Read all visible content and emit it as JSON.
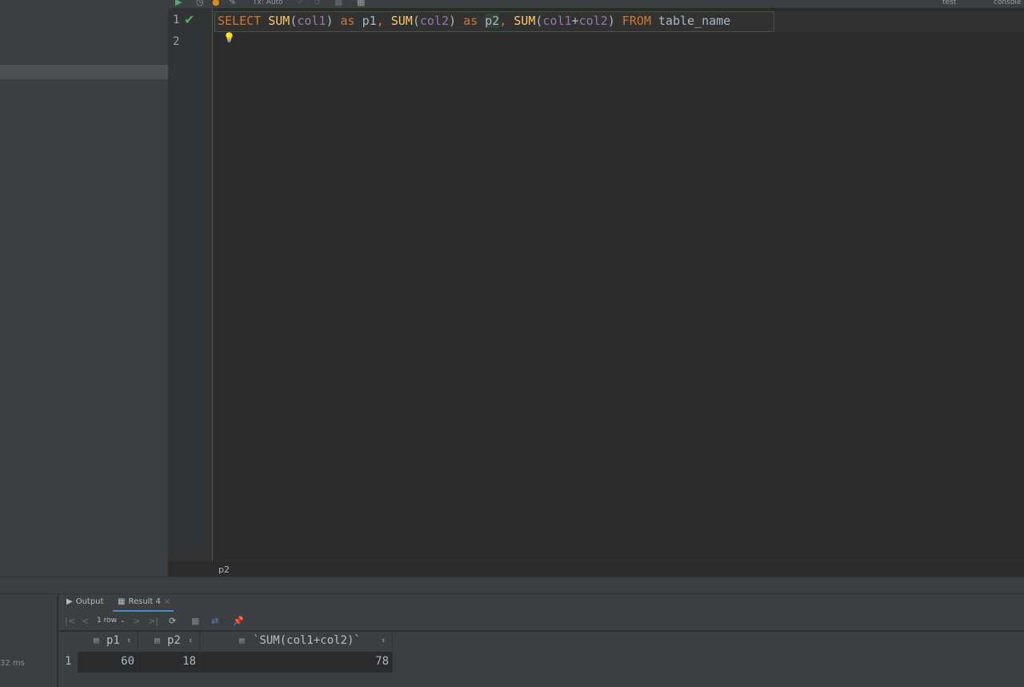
{
  "toolbar": {
    "tx_mode": "Tx: Auto",
    "datasource": "test",
    "console": "console"
  },
  "editor": {
    "line_numbers": [
      "1",
      "2"
    ],
    "code": {
      "select": "SELECT",
      "sum1": "SUM",
      "col1a": "col1",
      "as1": "as",
      "p1": "p1",
      "sum2": "SUM",
      "col2a": "col2",
      "as2": "as",
      "p2": "p2",
      "sum3": "SUM",
      "col1b": "col1",
      "plus": "+",
      "col2b": "col2",
      "from": "FROM",
      "table": "table_name"
    }
  },
  "breadcrumb": "p2",
  "bottom": {
    "time": "32 ms",
    "tabs": [
      {
        "label": "Output"
      },
      {
        "label": "Result 4"
      }
    ],
    "row_count": "1 row",
    "columns": [
      "p1",
      "p2",
      "`SUM(col1+col2)`"
    ],
    "rows": [
      {
        "num": "1",
        "cells": [
          "60",
          "18",
          "78"
        ]
      }
    ]
  },
  "colors": {
    "keyword": "#cc7832",
    "function": "#ffc66d",
    "column": "#9876aa",
    "check": "#4caf50"
  }
}
